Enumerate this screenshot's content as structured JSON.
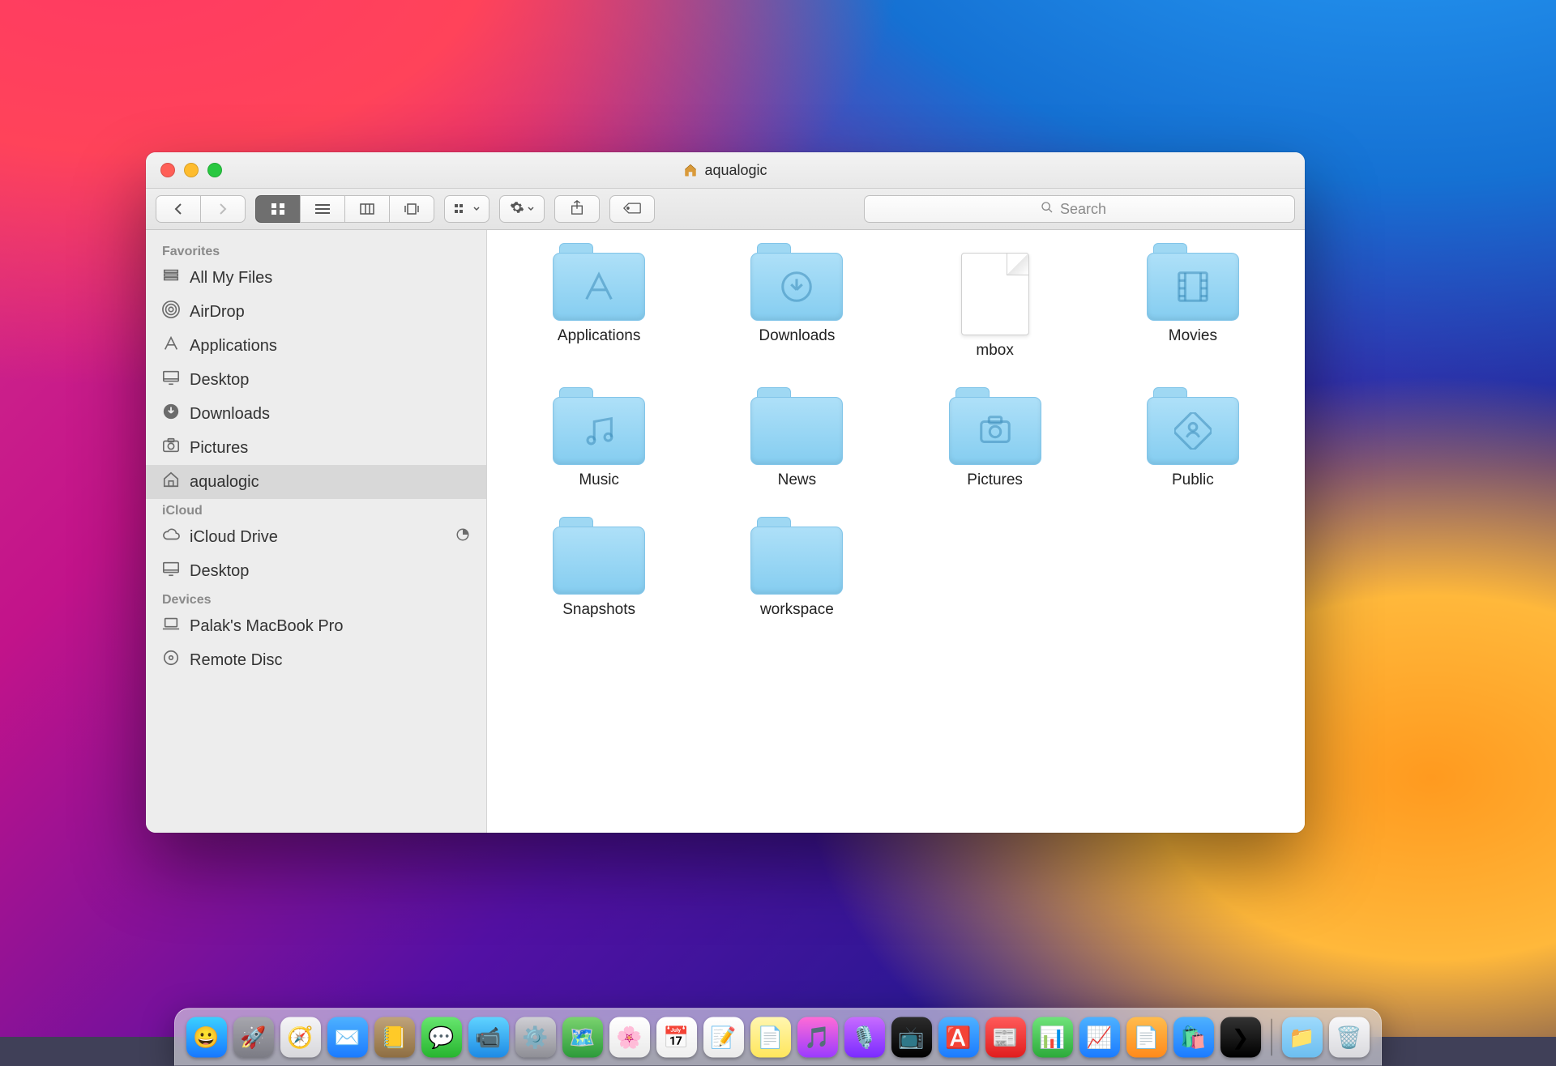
{
  "window": {
    "title": "aqualogic"
  },
  "search": {
    "placeholder": "Search"
  },
  "sidebar": {
    "sections": [
      {
        "title": "Favorites",
        "items": [
          {
            "label": "All My Files",
            "icon": "all-my-files-icon"
          },
          {
            "label": "AirDrop",
            "icon": "airdrop-icon"
          },
          {
            "label": "Applications",
            "icon": "applications-icon"
          },
          {
            "label": "Desktop",
            "icon": "desktop-icon"
          },
          {
            "label": "Downloads",
            "icon": "downloads-icon"
          },
          {
            "label": "Pictures",
            "icon": "pictures-icon"
          },
          {
            "label": "aqualogic",
            "icon": "home-icon",
            "selected": true
          }
        ]
      },
      {
        "title": "iCloud",
        "items": [
          {
            "label": "iCloud Drive",
            "icon": "cloud-icon",
            "right": "progress-icon"
          },
          {
            "label": "Desktop",
            "icon": "desktop-icon"
          }
        ]
      },
      {
        "title": "Devices",
        "items": [
          {
            "label": "Palak's MacBook Pro",
            "icon": "laptop-icon"
          },
          {
            "label": "Remote Disc",
            "icon": "disc-icon"
          }
        ]
      }
    ]
  },
  "folderitems": [
    {
      "label": "Applications",
      "type": "folder",
      "glyph": "applications"
    },
    {
      "label": "Downloads",
      "type": "folder",
      "glyph": "downloads"
    },
    {
      "label": "mbox",
      "type": "file",
      "glyph": ""
    },
    {
      "label": "Movies",
      "type": "folder",
      "glyph": "movies"
    },
    {
      "label": "Music",
      "type": "folder",
      "glyph": "music"
    },
    {
      "label": "News",
      "type": "folder",
      "glyph": ""
    },
    {
      "label": "Pictures",
      "type": "folder",
      "glyph": "pictures"
    },
    {
      "label": "Public",
      "type": "folder",
      "glyph": "public"
    },
    {
      "label": "Snapshots",
      "type": "folder",
      "glyph": ""
    },
    {
      "label": "workspace",
      "type": "folder",
      "glyph": ""
    }
  ],
  "dock": [
    {
      "name": "finder",
      "color": "linear-gradient(#3bd0ff,#1677ff)",
      "glyph": "😀"
    },
    {
      "name": "launchpad",
      "color": "linear-gradient(#a6a6ad,#7b7b84)",
      "glyph": "🚀"
    },
    {
      "name": "safari",
      "color": "linear-gradient(#f5f5f7,#d7d7db)",
      "glyph": "🧭"
    },
    {
      "name": "mail",
      "color": "linear-gradient(#4db1ff,#1b7bff)",
      "glyph": "✉️"
    },
    {
      "name": "contacts",
      "color": "linear-gradient(#bfa37a,#8e6e42)",
      "glyph": "📒"
    },
    {
      "name": "messages",
      "color": "linear-gradient(#66e66e,#27b52f)",
      "glyph": "💬"
    },
    {
      "name": "facetime",
      "color": "linear-gradient(#5fd3ff,#1d8ae5)",
      "glyph": "📹"
    },
    {
      "name": "preferences",
      "color": "linear-gradient(#cfcfd4,#8e8e95)",
      "glyph": "⚙️"
    },
    {
      "name": "maps",
      "color": "linear-gradient(#7ad36e,#2c9a3a)",
      "glyph": "🗺️"
    },
    {
      "name": "photos",
      "color": "linear-gradient(#ffffff,#e9e9e9)",
      "glyph": "🌸"
    },
    {
      "name": "calendar",
      "color": "linear-gradient(#ffffff,#efefef)",
      "glyph": "📅"
    },
    {
      "name": "reminders",
      "color": "linear-gradient(#ffffff,#eaeaea)",
      "glyph": "📝"
    },
    {
      "name": "notes",
      "color": "linear-gradient(#fff6b0,#ffe65c)",
      "glyph": "📄"
    },
    {
      "name": "itunes",
      "color": "linear-gradient(#ff6bd6,#9b3bff)",
      "glyph": "🎵"
    },
    {
      "name": "podcasts",
      "color": "linear-gradient(#c86bff,#7a2bff)",
      "glyph": "🎙️"
    },
    {
      "name": "tv",
      "color": "linear-gradient(#2c2c2c,#000)",
      "glyph": "📺"
    },
    {
      "name": "appstore",
      "color": "linear-gradient(#4db1ff,#1b7bff)",
      "glyph": "🅰️"
    },
    {
      "name": "news",
      "color": "linear-gradient(#ff5a5a,#e01e1e)",
      "glyph": "📰"
    },
    {
      "name": "numbers",
      "color": "linear-gradient(#6fe37a,#2caa3a)",
      "glyph": "📊"
    },
    {
      "name": "keynote",
      "color": "linear-gradient(#4db1ff,#1b7bff)",
      "glyph": "📈"
    },
    {
      "name": "pages",
      "color": "linear-gradient(#ffbc4d,#ff8a1b)",
      "glyph": "📄"
    },
    {
      "name": "appstore2",
      "color": "linear-gradient(#4db1ff,#1b7bff)",
      "glyph": "🛍️"
    },
    {
      "name": "terminal",
      "color": "linear-gradient(#333,#000)",
      "glyph": "❯"
    },
    {
      "name": "downloads-stack",
      "color": "linear-gradient(#9edafc,#6cbef0)",
      "glyph": "📁"
    },
    {
      "name": "trash",
      "color": "linear-gradient(#f7f7f9,#d9d9dd)",
      "glyph": "🗑️"
    }
  ]
}
